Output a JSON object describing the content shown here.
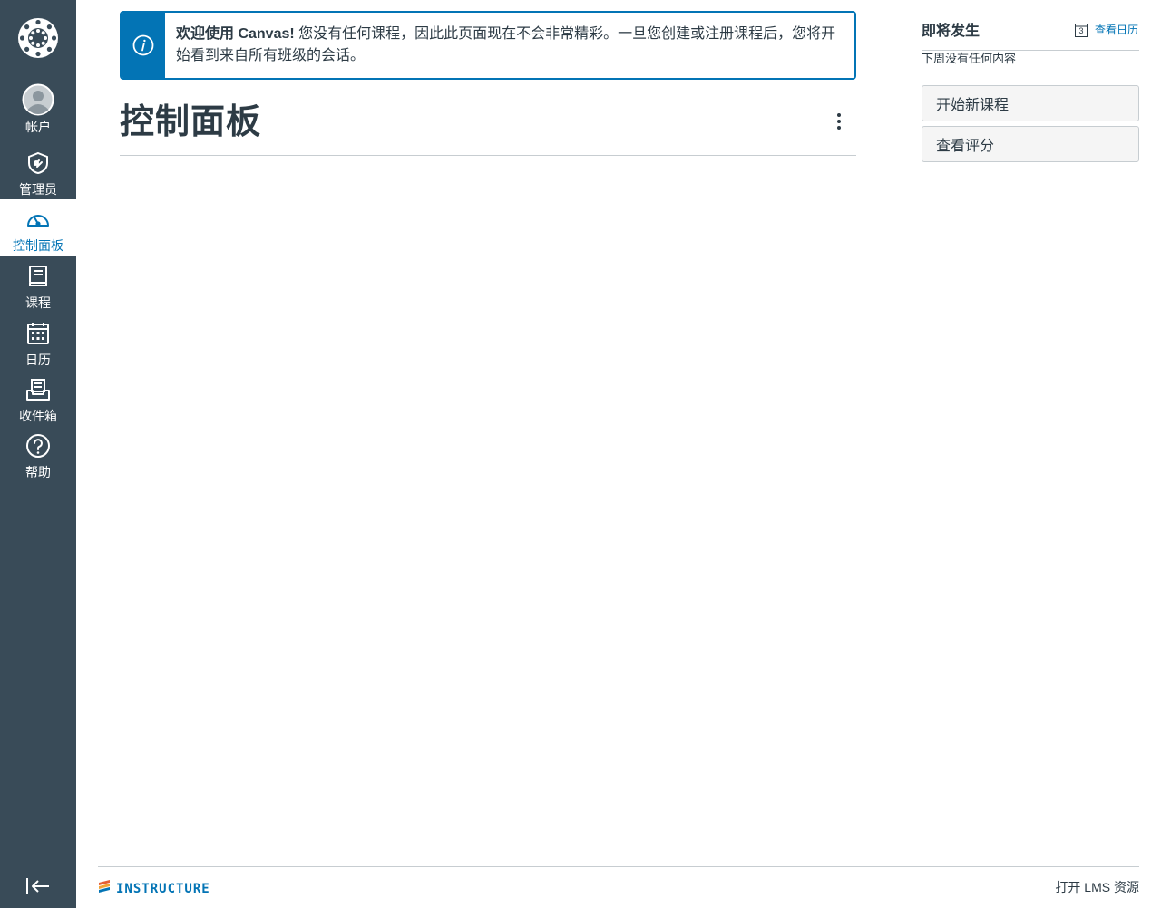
{
  "nav": {
    "account": {
      "label": "帐户",
      "icon": "avatar-icon"
    },
    "admin": {
      "label": "管理员",
      "icon": "shield-icon"
    },
    "dashboard": {
      "label": "控制面板",
      "icon": "speedometer-icon",
      "active": true
    },
    "courses": {
      "label": "课程",
      "icon": "book-icon"
    },
    "calendar": {
      "label": "日历",
      "icon": "calendar-icon"
    },
    "inbox": {
      "label": "收件箱",
      "icon": "inbox-icon"
    },
    "help": {
      "label": "帮助",
      "icon": "question-icon"
    }
  },
  "alert": {
    "title": "欢迎使用 Canvas!",
    "message": "您没有任何课程，因此此页面现在不会非常精彩。一旦您创建或注册课程后，您将开始看到来自所有班级的会话。"
  },
  "main": {
    "title": "控制面板"
  },
  "sidebar": {
    "coming_up_title": "即将发生",
    "view_calendar": "查看日历",
    "calendar_day": "3",
    "coming_up_empty": "下周没有任何内容",
    "start_new_course": "开始新课程",
    "view_grades": "查看评分"
  },
  "footer": {
    "logo_text": "INSTRUCTURE",
    "link": "打开 LMS 资源"
  },
  "colors": {
    "nav_bg": "#394b58",
    "accent": "#0374b5",
    "text": "#2d3b45"
  }
}
